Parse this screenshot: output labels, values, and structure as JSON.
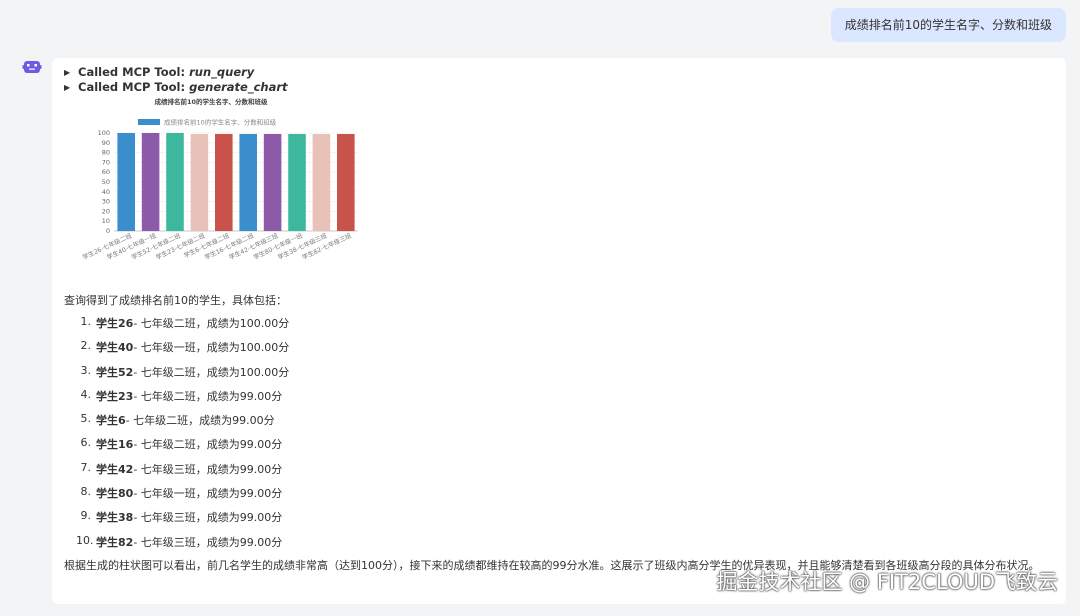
{
  "user_message": "成绩排名前10的学生名字、分数和班级",
  "tool_calls": [
    {
      "prefix": "Called MCP Tool: ",
      "name": "run_query"
    },
    {
      "prefix": "Called MCP Tool: ",
      "name": "generate_chart"
    }
  ],
  "chart_data": {
    "type": "bar",
    "title": "成绩排名前10的学生名字、分数和班级",
    "legend": "成绩排名前10的学生名字、分数和班级",
    "legend_position": "top",
    "categories": [
      "学生26-七年级二班",
      "学生40-七年级一班",
      "学生52-七年级二班",
      "学生23-七年级二班",
      "学生6-七年级二班",
      "学生16-七年级二班",
      "学生42-七年级三班",
      "学生80-七年级一班",
      "学生38-七年级三班",
      "学生82-七年级三班"
    ],
    "values": [
      100,
      100,
      100,
      99,
      99,
      99,
      99,
      99,
      99,
      99
    ],
    "ylim": [
      0,
      100
    ],
    "yticks": [
      0,
      10,
      20,
      30,
      40,
      50,
      60,
      70,
      80,
      90,
      100
    ],
    "colors": [
      "#3a8ecb",
      "#8c5aa8",
      "#3db89e",
      "#e8c2b9",
      "#c9524b"
    ],
    "grid": true
  },
  "summary": {
    "intro": "查询得到了成绩排名前10的学生，具体包括：",
    "items": [
      {
        "num": "1.",
        "name": "学生26",
        "detail": " - 七年级二班，成绩为100.00分"
      },
      {
        "num": "2.",
        "name": "学生40",
        "detail": " - 七年级一班，成绩为100.00分"
      },
      {
        "num": "3.",
        "name": "学生52",
        "detail": " - 七年级二班，成绩为100.00分"
      },
      {
        "num": "4.",
        "name": "学生23",
        "detail": " - 七年级二班，成绩为99.00分"
      },
      {
        "num": "5.",
        "name": "学生6",
        "detail": " - 七年级二班，成绩为99.00分"
      },
      {
        "num": "6.",
        "name": "学生16",
        "detail": " - 七年级二班，成绩为99.00分"
      },
      {
        "num": "7.",
        "name": "学生42",
        "detail": " - 七年级三班，成绩为99.00分"
      },
      {
        "num": "8.",
        "name": "学生80",
        "detail": " - 七年级一班，成绩为99.00分"
      },
      {
        "num": "9.",
        "name": "学生38",
        "detail": " - 七年级三班，成绩为99.00分"
      },
      {
        "num": "10.",
        "name": "学生82",
        "detail": " - 七年级三班，成绩为99.00分"
      }
    ],
    "conclusion": "根据生成的柱状图可以看出，前几名学生的成绩非常高（达到100分），接下来的成绩都维持在较高的99分水准。这展示了班级内高分学生的优异表现，并且能够清楚看到各班级高分段的具体分布状况。"
  },
  "watermark": "掘金技术社区 @ FIT2CLOUD飞致云",
  "bot_icon": "robot-icon",
  "accent_color": "#6b5ce7"
}
